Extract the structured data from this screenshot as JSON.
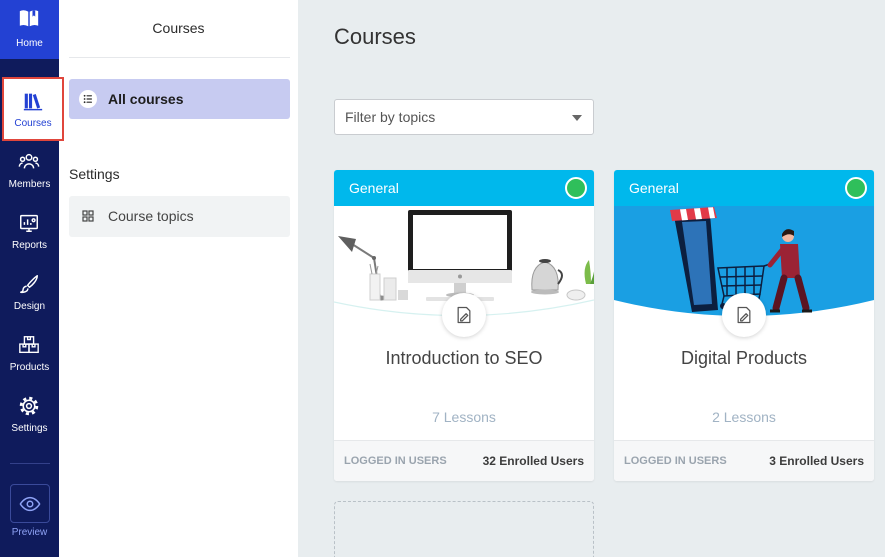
{
  "nav": {
    "items": [
      {
        "label": "Home",
        "icon": "book-open-icon"
      },
      {
        "label": "Courses",
        "icon": "books-icon",
        "active": true
      },
      {
        "label": "Members",
        "icon": "users-icon"
      },
      {
        "label": "Reports",
        "icon": "reports-icon"
      },
      {
        "label": "Design",
        "icon": "paintbrush-icon"
      },
      {
        "label": "Products",
        "icon": "boxes-icon"
      },
      {
        "label": "Settings",
        "icon": "gear-icon"
      }
    ],
    "preview": {
      "label": "Preview",
      "icon": "eye-icon"
    }
  },
  "subnav": {
    "title": "Courses",
    "items": [
      {
        "label": "All courses",
        "icon": "list-icon",
        "active": true
      }
    ],
    "settings_heading": "Settings",
    "settings_items": [
      {
        "label": "Course topics",
        "icon": "grid-icon"
      }
    ]
  },
  "main": {
    "title": "Courses",
    "filter": {
      "placeholder": "Filter by topics",
      "icon": "chevron-down-icon"
    },
    "courses": [
      {
        "category": "General",
        "title": "Introduction to SEO",
        "lessons": "7 Lessons",
        "access": "LOGGED IN USERS",
        "enrolled": "32 Enrolled Users",
        "badge_icon": "edit-document-icon"
      },
      {
        "category": "General",
        "title": "Digital Products",
        "lessons": "2 Lessons",
        "access": "LOGGED IN USERS",
        "enrolled": "3 Enrolled Users",
        "badge_icon": "edit-document-icon"
      }
    ]
  },
  "colors": {
    "nav_bg": "#0f1b5c",
    "home_bg": "#2341d3",
    "accent": "#2341d3",
    "card_header": "#00b8ec",
    "status": "#2fbf5b",
    "outline": "#e0463c",
    "active_sub": "#c7cbf1",
    "main_bg": "#e8edef"
  }
}
